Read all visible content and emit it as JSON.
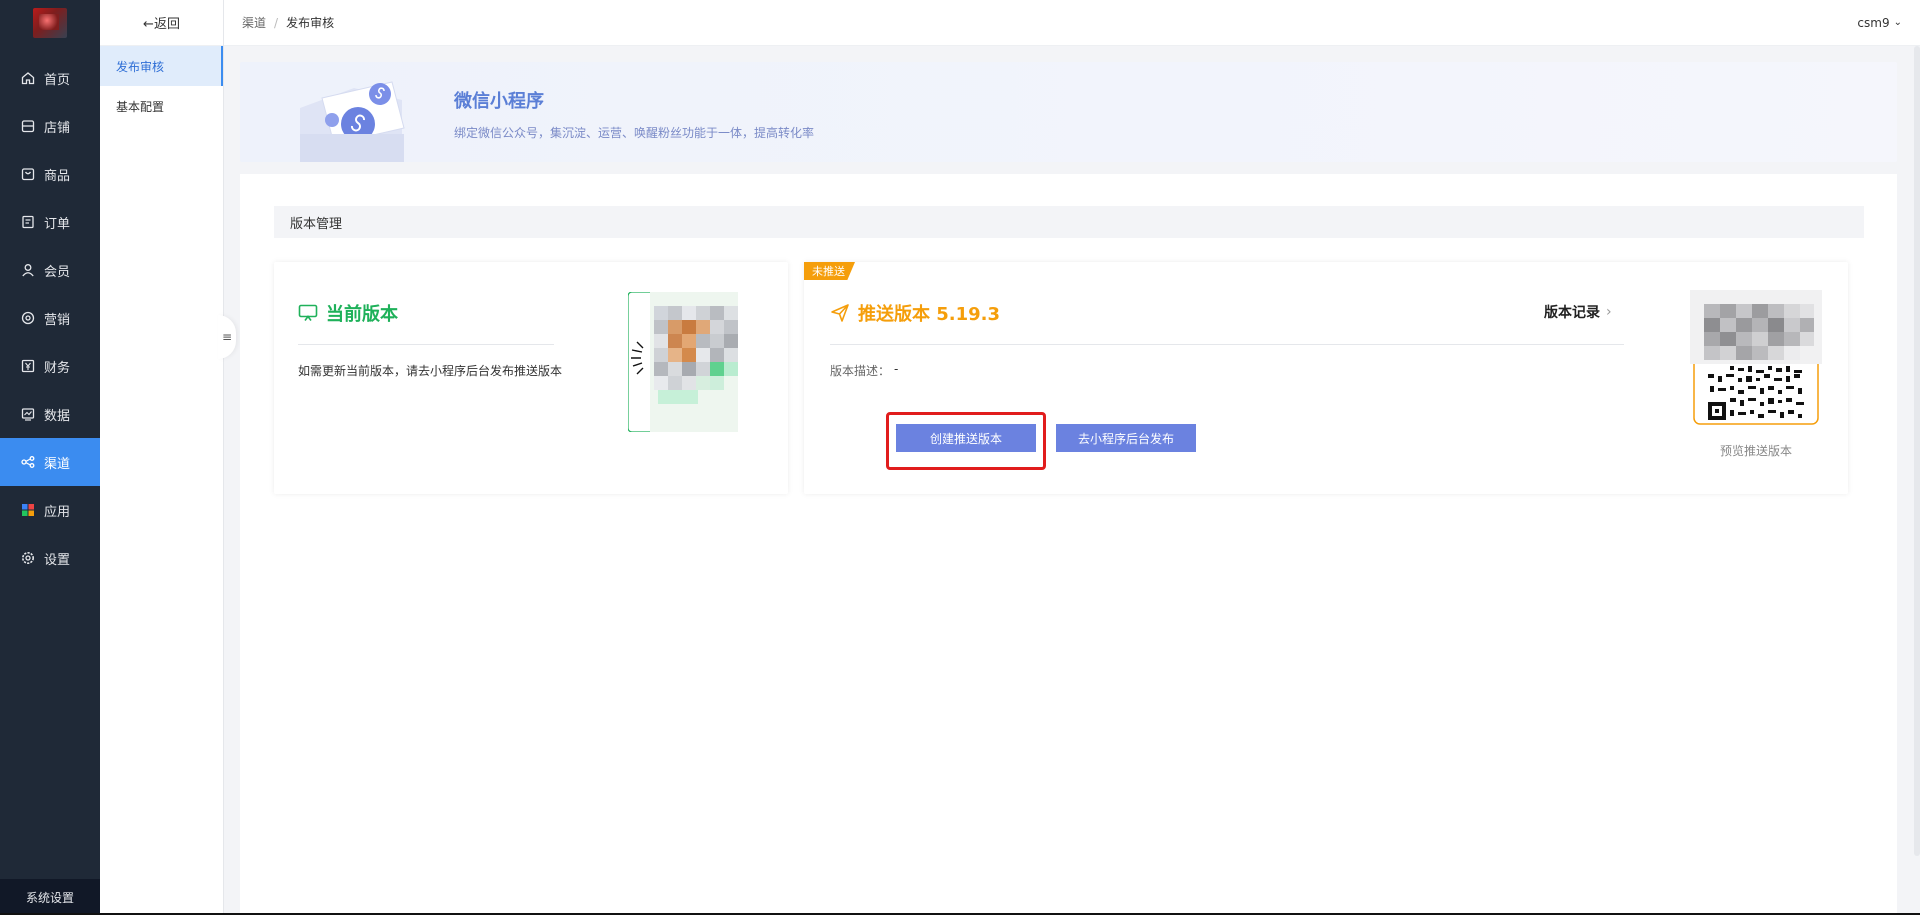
{
  "sidebar": {
    "items": [
      {
        "label": "首页",
        "icon": "home-icon"
      },
      {
        "label": "店铺",
        "icon": "store-icon"
      },
      {
        "label": "商品",
        "icon": "bag-icon"
      },
      {
        "label": "订单",
        "icon": "order-icon"
      },
      {
        "label": "会员",
        "icon": "user-icon"
      },
      {
        "label": "营销",
        "icon": "marketing-icon"
      },
      {
        "label": "财务",
        "icon": "finance-icon"
      },
      {
        "label": "数据",
        "icon": "chart-icon"
      },
      {
        "label": "渠道",
        "icon": "channel-icon"
      },
      {
        "label": "应用",
        "icon": "apps-icon"
      },
      {
        "label": "设置",
        "icon": "gear-icon"
      }
    ],
    "active": "渠道",
    "system_settings": "系统设置"
  },
  "subsidebar": {
    "back_label": "←返回",
    "items": [
      {
        "label": "发布审核"
      },
      {
        "label": "基本配置"
      }
    ]
  },
  "header": {
    "breadcrumb": [
      "渠道",
      "发布审核"
    ],
    "breadcrumb_sep": "/",
    "user": "csm9"
  },
  "banner": {
    "title": "微信小程序",
    "subtitle": "绑定微信公众号，集沉淀、运营、唤醒粉丝功能于一体，提高转化率"
  },
  "version": {
    "section_title": "版本管理",
    "current": {
      "title": "当前版本",
      "desc": "如需更新当前版本，请去小程序后台发布推送版本"
    },
    "push": {
      "tag": "未推送",
      "title": "推送版本 5.19.3",
      "record_label": "版本记录",
      "desc_label": "版本描述：",
      "desc_value": "-",
      "create_button": "创建推送版本",
      "publish_button": "去小程序后台发布",
      "preview_label": "预览推送版本"
    }
  },
  "colors": {
    "sidebar_bg": "#1f2937",
    "active_blue": "#3b8cf0",
    "green": "#1fb15a",
    "orange": "#f59e0b",
    "button": "#6b82e0",
    "highlight": "#e11d1d"
  }
}
